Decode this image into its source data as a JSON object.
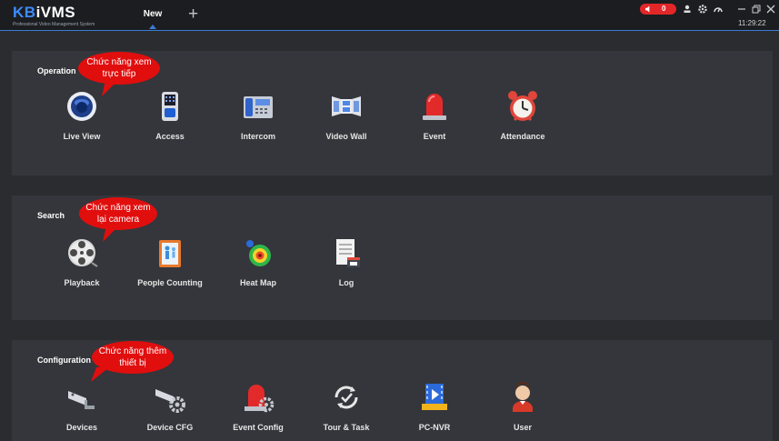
{
  "header": {
    "brand_prefix": "KB",
    "brand_main": "iVMS",
    "brand_tagline": "Professional Video Management System",
    "tab_label": "New",
    "add_tab_symbol": "+",
    "alarm_count": "0",
    "clock": "11:29:22"
  },
  "sections": {
    "operation": {
      "title": "Operation",
      "items": [
        "Live View",
        "Access",
        "Intercom",
        "Video Wall",
        "Event",
        "Attendance"
      ],
      "callout": [
        "Chức năng xem",
        "trực tiếp"
      ]
    },
    "search": {
      "title": "Search",
      "items": [
        "Playback",
        "People Counting",
        "Heat Map",
        "Log"
      ],
      "callout": [
        "Chức năng xem",
        "lại camera"
      ]
    },
    "configuration": {
      "title": "Configuration",
      "items": [
        "Devices",
        "Device CFG",
        "Event Config",
        "Tour & Task",
        "PC-NVR",
        "User"
      ],
      "callout": [
        "Chức năng thêm",
        "thiết bị"
      ]
    }
  },
  "colors": {
    "accent": "#3a7bd5",
    "alarm": "#e32628",
    "callout": "#e10e0e",
    "panel": "#34363b"
  }
}
